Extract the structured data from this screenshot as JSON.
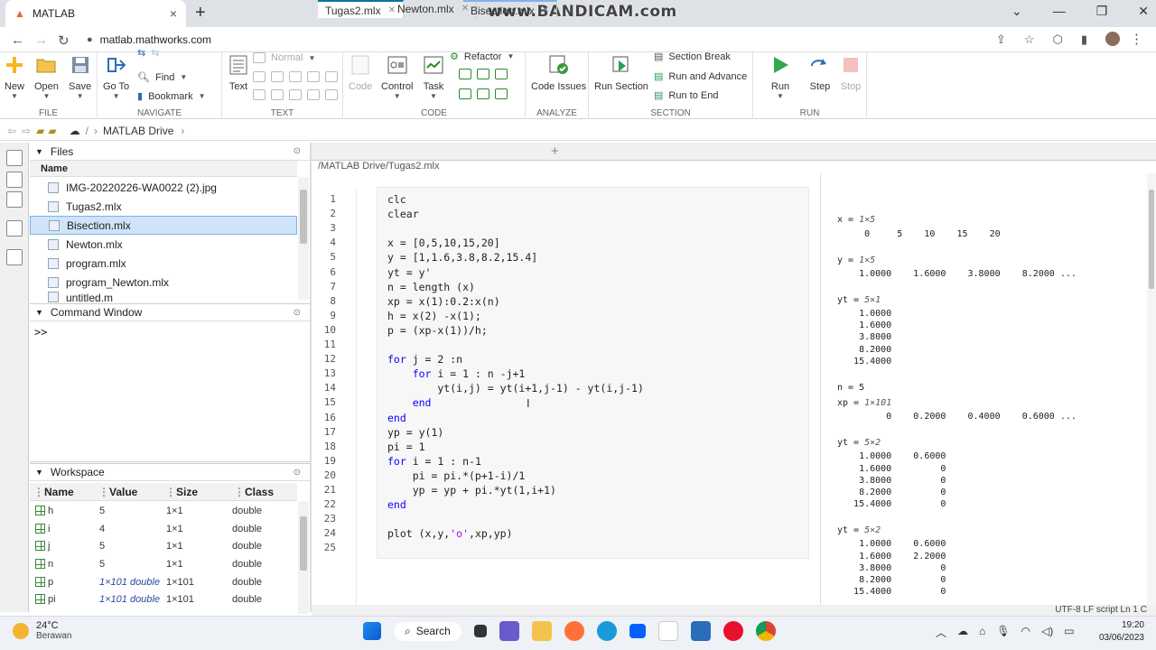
{
  "browser": {
    "tab_title": "MATLAB",
    "url": "matlab.mathworks.com",
    "watermark": "www.BANDICAM.com"
  },
  "toolstrip": {
    "file": {
      "label": "FILE",
      "new": "New",
      "open": "Open",
      "save": "Save"
    },
    "navigate": {
      "label": "NAVIGATE",
      "goto": "Go To",
      "find": "Find",
      "bookmark": "Bookmark"
    },
    "text": {
      "label": "TEXT",
      "text": "Text",
      "normal": "Normal"
    },
    "code": {
      "label": "CODE",
      "code": "Code",
      "control": "Control",
      "task": "Task",
      "refactor": "Refactor"
    },
    "analyze": {
      "label": "ANALYZE",
      "code_issues": "Code Issues"
    },
    "section": {
      "label": "SECTION",
      "run_section": "Run Section",
      "section_break": "Section Break",
      "run_and_advance": "Run and Advance",
      "run_to_end": "Run to End"
    },
    "run": {
      "label": "RUN",
      "run": "Run",
      "step": "Step",
      "stop": "Stop"
    }
  },
  "pathbar": {
    "sep": "/",
    "crumb": "MATLAB Drive"
  },
  "files": {
    "title": "Files",
    "col_name": "Name",
    "items": [
      "IMG-20220226-WA0022 (2).jpg",
      "Tugas2.mlx",
      "Bisection.mlx",
      "Newton.mlx",
      "program.mlx",
      "program_Newton.mlx",
      "untitled.m"
    ]
  },
  "command_window": {
    "title": "Command Window",
    "prompt": ">>"
  },
  "workspace": {
    "title": "Workspace",
    "cols": [
      "Name",
      "Value",
      "Size",
      "Class"
    ],
    "rows": [
      [
        "h",
        "5",
        "1×1",
        "double"
      ],
      [
        "i",
        "4",
        "1×1",
        "double"
      ],
      [
        "j",
        "5",
        "1×1",
        "double"
      ],
      [
        "n",
        "5",
        "1×1",
        "double"
      ],
      [
        "p",
        "1×101 double",
        "1×101",
        "double"
      ],
      [
        "pi",
        "1×101 double",
        "1×101",
        "double"
      ]
    ]
  },
  "editor": {
    "tabs": [
      "Tugas2.mlx",
      "Newton.mlx",
      "Bisection.mlx"
    ],
    "add_tab": "+",
    "path": "/MATLAB Drive/Tugas2.mlx",
    "line_numbers": [
      "1",
      "2",
      "3",
      "4",
      "5",
      "6",
      "7",
      "8",
      "9",
      "10",
      "11",
      "12",
      "13",
      "14",
      "15",
      "16",
      "17",
      "18",
      "19",
      "20",
      "21",
      "22",
      "23",
      "24",
      "25"
    ],
    "lines": [
      "clc",
      "clear",
      "",
      "x = [0,5,10,15,20]",
      "y = [1,1.6,3.8,8.2,15.4]",
      "yt = y'",
      "n = length (x)",
      "xp = x(1):0.2:x(n)",
      "h = x(2) -x(1);",
      "p = (xp-x(1))/h;",
      "",
      "for j = 2 :n",
      "    for i = 1 : n -j+1",
      "        yt(i,j) = yt(i+1,j-1) - yt(i,j-1)",
      "    end",
      "end",
      "yp = y(1)",
      "pi = 1",
      "for i = 1 : n-1",
      "    pi = pi.*(p+1-i)/1",
      "    yp = yp + pi.*yt(1,i+1)",
      "end",
      "",
      "plot (x,y,'o',xp,yp)",
      ""
    ]
  },
  "output": {
    "x_label": "x = ",
    "x_dim": "1×5",
    "x_vals": "     0     5    10    15    20",
    "y_label": "y = ",
    "y_dim": "1×5",
    "y_vals": "    1.0000    1.6000    3.8000    8.2000 ...",
    "yt1_label": "yt = ",
    "yt1_dim": "5×1",
    "yt1_vals": [
      "    1.0000",
      "    1.6000",
      "    3.8000",
      "    8.2000",
      "   15.4000"
    ],
    "n_line": "n = 5",
    "xp_label": "xp = ",
    "xp_dim": "1×101",
    "xp_vals": "         0    0.2000    0.4000    0.6000 ...",
    "yt2_label": "yt = ",
    "yt2_dim": "5×2",
    "yt2_vals": [
      "    1.0000    0.6000",
      "    1.6000         0",
      "    3.8000         0",
      "    8.2000         0",
      "   15.4000         0"
    ],
    "yt3_label": "yt = ",
    "yt3_dim": "5×2",
    "yt3_vals": [
      "    1.0000    0.6000",
      "    1.6000    2.2000",
      "    3.8000         0",
      "    8.2000         0",
      "   15.4000         0"
    ]
  },
  "statusbar": "UTF-8   LF   script   Ln 1  C",
  "taskbar": {
    "temp": "24°C",
    "weather": "Berawan",
    "search": "Search",
    "time": "19:20",
    "date": "03/06/2023"
  }
}
